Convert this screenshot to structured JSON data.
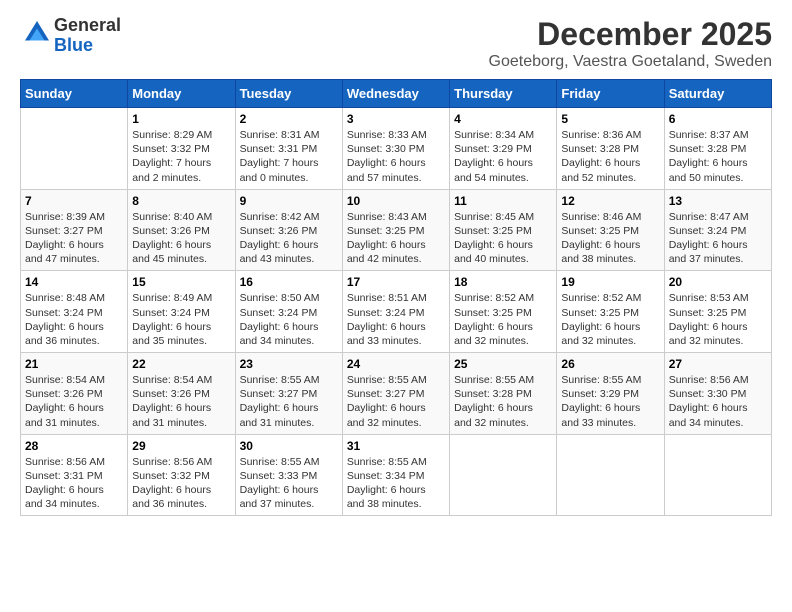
{
  "logo": {
    "general": "General",
    "blue": "Blue"
  },
  "title": "December 2025",
  "subtitle": "Goeteborg, Vaestra Goetaland, Sweden",
  "days_of_week": [
    "Sunday",
    "Monday",
    "Tuesday",
    "Wednesday",
    "Thursday",
    "Friday",
    "Saturday"
  ],
  "weeks": [
    [
      {
        "num": "",
        "info": ""
      },
      {
        "num": "1",
        "info": "Sunrise: 8:29 AM\nSunset: 3:32 PM\nDaylight: 7 hours\nand 2 minutes."
      },
      {
        "num": "2",
        "info": "Sunrise: 8:31 AM\nSunset: 3:31 PM\nDaylight: 7 hours\nand 0 minutes."
      },
      {
        "num": "3",
        "info": "Sunrise: 8:33 AM\nSunset: 3:30 PM\nDaylight: 6 hours\nand 57 minutes."
      },
      {
        "num": "4",
        "info": "Sunrise: 8:34 AM\nSunset: 3:29 PM\nDaylight: 6 hours\nand 54 minutes."
      },
      {
        "num": "5",
        "info": "Sunrise: 8:36 AM\nSunset: 3:28 PM\nDaylight: 6 hours\nand 52 minutes."
      },
      {
        "num": "6",
        "info": "Sunrise: 8:37 AM\nSunset: 3:28 PM\nDaylight: 6 hours\nand 50 minutes."
      }
    ],
    [
      {
        "num": "7",
        "info": "Sunrise: 8:39 AM\nSunset: 3:27 PM\nDaylight: 6 hours\nand 47 minutes."
      },
      {
        "num": "8",
        "info": "Sunrise: 8:40 AM\nSunset: 3:26 PM\nDaylight: 6 hours\nand 45 minutes."
      },
      {
        "num": "9",
        "info": "Sunrise: 8:42 AM\nSunset: 3:26 PM\nDaylight: 6 hours\nand 43 minutes."
      },
      {
        "num": "10",
        "info": "Sunrise: 8:43 AM\nSunset: 3:25 PM\nDaylight: 6 hours\nand 42 minutes."
      },
      {
        "num": "11",
        "info": "Sunrise: 8:45 AM\nSunset: 3:25 PM\nDaylight: 6 hours\nand 40 minutes."
      },
      {
        "num": "12",
        "info": "Sunrise: 8:46 AM\nSunset: 3:25 PM\nDaylight: 6 hours\nand 38 minutes."
      },
      {
        "num": "13",
        "info": "Sunrise: 8:47 AM\nSunset: 3:24 PM\nDaylight: 6 hours\nand 37 minutes."
      }
    ],
    [
      {
        "num": "14",
        "info": "Sunrise: 8:48 AM\nSunset: 3:24 PM\nDaylight: 6 hours\nand 36 minutes."
      },
      {
        "num": "15",
        "info": "Sunrise: 8:49 AM\nSunset: 3:24 PM\nDaylight: 6 hours\nand 35 minutes."
      },
      {
        "num": "16",
        "info": "Sunrise: 8:50 AM\nSunset: 3:24 PM\nDaylight: 6 hours\nand 34 minutes."
      },
      {
        "num": "17",
        "info": "Sunrise: 8:51 AM\nSunset: 3:24 PM\nDaylight: 6 hours\nand 33 minutes."
      },
      {
        "num": "18",
        "info": "Sunrise: 8:52 AM\nSunset: 3:25 PM\nDaylight: 6 hours\nand 32 minutes."
      },
      {
        "num": "19",
        "info": "Sunrise: 8:52 AM\nSunset: 3:25 PM\nDaylight: 6 hours\nand 32 minutes."
      },
      {
        "num": "20",
        "info": "Sunrise: 8:53 AM\nSunset: 3:25 PM\nDaylight: 6 hours\nand 32 minutes."
      }
    ],
    [
      {
        "num": "21",
        "info": "Sunrise: 8:54 AM\nSunset: 3:26 PM\nDaylight: 6 hours\nand 31 minutes."
      },
      {
        "num": "22",
        "info": "Sunrise: 8:54 AM\nSunset: 3:26 PM\nDaylight: 6 hours\nand 31 minutes."
      },
      {
        "num": "23",
        "info": "Sunrise: 8:55 AM\nSunset: 3:27 PM\nDaylight: 6 hours\nand 31 minutes."
      },
      {
        "num": "24",
        "info": "Sunrise: 8:55 AM\nSunset: 3:27 PM\nDaylight: 6 hours\nand 32 minutes."
      },
      {
        "num": "25",
        "info": "Sunrise: 8:55 AM\nSunset: 3:28 PM\nDaylight: 6 hours\nand 32 minutes."
      },
      {
        "num": "26",
        "info": "Sunrise: 8:55 AM\nSunset: 3:29 PM\nDaylight: 6 hours\nand 33 minutes."
      },
      {
        "num": "27",
        "info": "Sunrise: 8:56 AM\nSunset: 3:30 PM\nDaylight: 6 hours\nand 34 minutes."
      }
    ],
    [
      {
        "num": "28",
        "info": "Sunrise: 8:56 AM\nSunset: 3:31 PM\nDaylight: 6 hours\nand 34 minutes."
      },
      {
        "num": "29",
        "info": "Sunrise: 8:56 AM\nSunset: 3:32 PM\nDaylight: 6 hours\nand 36 minutes."
      },
      {
        "num": "30",
        "info": "Sunrise: 8:55 AM\nSunset: 3:33 PM\nDaylight: 6 hours\nand 37 minutes."
      },
      {
        "num": "31",
        "info": "Sunrise: 8:55 AM\nSunset: 3:34 PM\nDaylight: 6 hours\nand 38 minutes."
      },
      {
        "num": "",
        "info": ""
      },
      {
        "num": "",
        "info": ""
      },
      {
        "num": "",
        "info": ""
      }
    ]
  ]
}
